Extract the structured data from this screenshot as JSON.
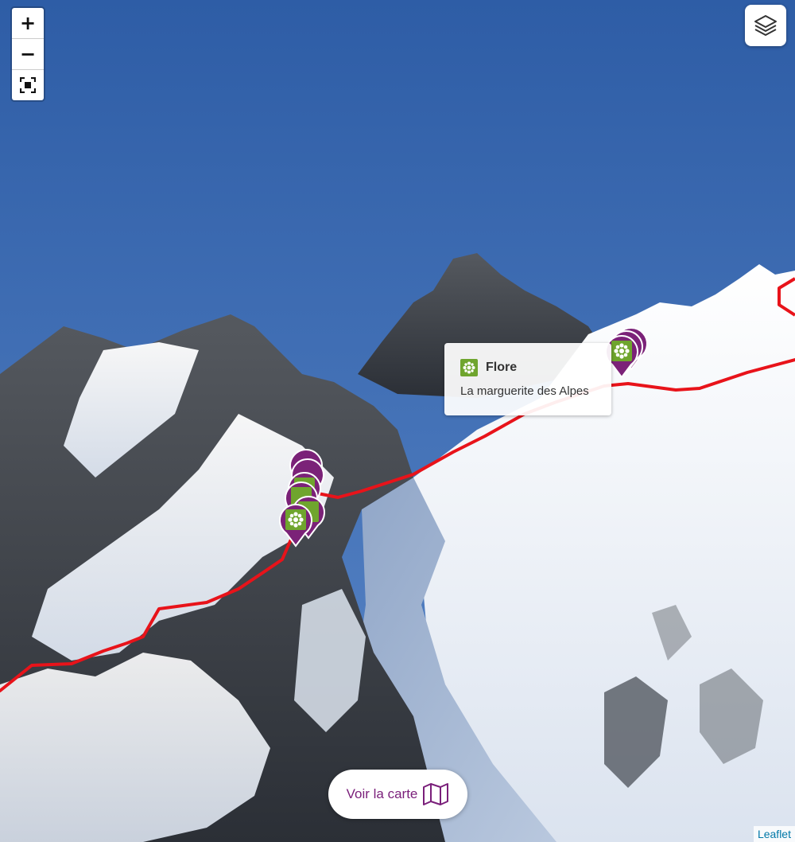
{
  "controls": {
    "zoom_in": "+",
    "zoom_out": "−",
    "fullscreen_icon": "fullscreen-icon",
    "layers_icon": "layers-icon"
  },
  "tooltip": {
    "category": "Flore",
    "name": "La marguerite des Alpes",
    "icon": "flower-icon"
  },
  "markers": [
    {
      "category": "Flore",
      "icon": "flower-icon",
      "group": "upper-right"
    },
    {
      "category": "Flore",
      "icon": "flower-icon",
      "group": "left-cluster"
    }
  ],
  "voir_carte": {
    "label": "Voir la carte",
    "icon": "map-icon"
  },
  "attribution": "Leaflet",
  "colors": {
    "trail": "#e8131a",
    "marker_fill": "#7b2278",
    "marker_inner": "#6fa52e",
    "sky": "#3f6fb3",
    "link": "#0078a8"
  }
}
